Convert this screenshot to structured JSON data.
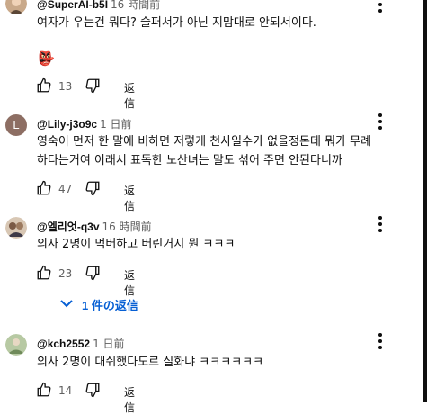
{
  "comments": [
    {
      "author": "@SuperAI-b5I",
      "time": "16 時間前",
      "text": "여자가 우는건 뭐다? 슬퍼서가 아닌 지맘대로 안되서이다.",
      "emoji": "👺",
      "likes": "13",
      "reply_label": "返信"
    },
    {
      "author": "@Lily-j3o9c",
      "time": "1 日前",
      "avatar_letter": "L",
      "text_line1": "영숙이 먼저 한 말에 비하면 저렇게 천사일수가 없을정돈데 뭐가 무례",
      "text_line2": "하다는거여 이래서 표독한 노산녀는 말도 섞어 주면 안된다니까",
      "likes": "47",
      "reply_label": "返信"
    },
    {
      "author": "@엘리엇-q3v",
      "time": "16 時間前",
      "text": "의사 2명이 먹버하고 버린거지 뭔 ㅋㅋㅋ",
      "likes": "23",
      "reply_label": "返信",
      "replies_toggle": "1 件の返信"
    },
    {
      "author": "@kch2552",
      "time": "1 日前",
      "text": "의사 2명이 대쉬했다도르 실화냐 ㅋㅋㅋㅋㅋㅋ",
      "likes": "14",
      "reply_label": "返信"
    }
  ],
  "colors": {
    "link_blue": "#065fd4",
    "secondary_text": "#606060",
    "avatar_l_bg": "#8d6e63"
  },
  "icons": [
    "thumbs-up-icon",
    "thumbs-down-icon",
    "more-vert-icon",
    "chevron-down-icon"
  ]
}
